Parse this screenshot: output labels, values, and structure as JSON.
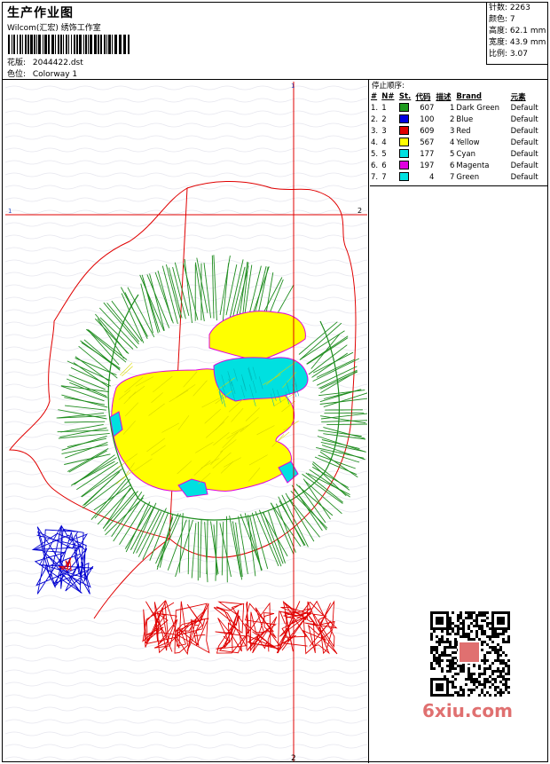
{
  "header": {
    "title": "生产作业图",
    "company": "Wilcom(汇宏) 绣饰工作室",
    "design_label": "花版:",
    "design_value": "2044422.dst",
    "colorway_label": "色位:",
    "colorway_value": "Colorway 1"
  },
  "stats": [
    {
      "label": "针数:",
      "value": "2263"
    },
    {
      "label": "颜色:",
      "value": "7"
    },
    {
      "label": "高度:",
      "value": "62.1 mm"
    },
    {
      "label": "宽度:",
      "value": "43.9 mm"
    },
    {
      "label": "比例:",
      "value": "3.07"
    }
  ],
  "legend": {
    "caption": "停止顺序:",
    "headers": [
      "#",
      "N#",
      "St.",
      "代码",
      "描述",
      "Brand",
      "元素"
    ],
    "rows": [
      {
        "idx": "1.",
        "n": "1",
        "st": "607",
        "code": "1",
        "desc": "Dark Green",
        "brand": "Default",
        "color": "#1e9a1e"
      },
      {
        "idx": "2.",
        "n": "2",
        "st": "100",
        "code": "2",
        "desc": "Blue",
        "brand": "Default",
        "color": "#0000e0"
      },
      {
        "idx": "3.",
        "n": "3",
        "st": "609",
        "code": "3",
        "desc": "Red",
        "brand": "Default",
        "color": "#e00000"
      },
      {
        "idx": "4.",
        "n": "4",
        "st": "567",
        "code": "4",
        "desc": "Yellow",
        "brand": "Default",
        "color": "#ffff00"
      },
      {
        "idx": "5.",
        "n": "5",
        "st": "177",
        "code": "5",
        "desc": "Cyan",
        "brand": "Default",
        "color": "#00e0e0"
      },
      {
        "idx": "6.",
        "n": "6",
        "st": "197",
        "code": "6",
        "desc": "Magenta",
        "brand": "Default",
        "color": "#e000e0"
      },
      {
        "idx": "7.",
        "n": "7",
        "st": "4",
        "code": "7",
        "desc": "Green",
        "brand": "Default",
        "color": "#00e0e0"
      }
    ]
  },
  "crosshair": {
    "top_label": "1",
    "bottom_label": "2",
    "left_label": "1",
    "right_label": "2"
  },
  "watermark": "6xiu.com",
  "colors": {
    "dark_green": "#1e8c1e",
    "blue": "#0000d0",
    "red": "#e00000",
    "yellow": "#ffff00",
    "cyan": "#00e0e0",
    "magenta": "#e000e0",
    "guide": "#e00000"
  }
}
